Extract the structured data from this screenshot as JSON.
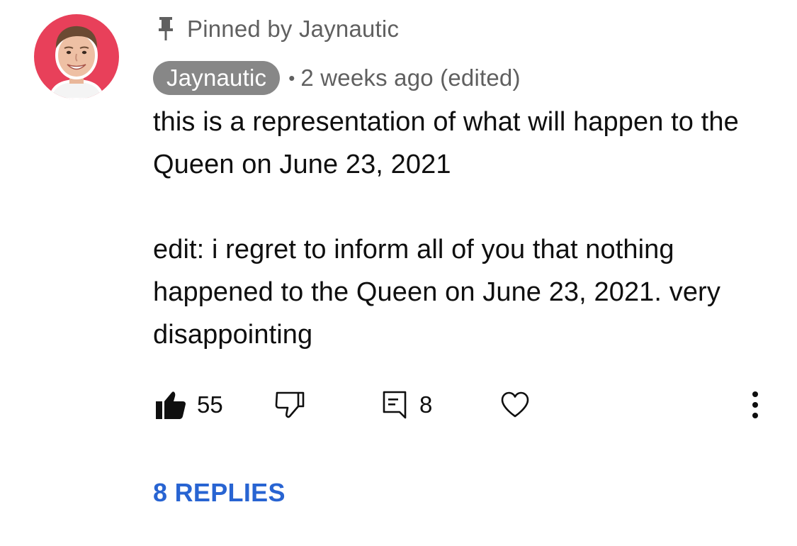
{
  "comment": {
    "pinned_text": "Pinned by Jaynautic",
    "author": "Jaynautic",
    "separator": "•",
    "timestamp": "2 weeks ago (edited)",
    "paragraphs": [
      "this is a representation of what will happen to the Queen on June 23, 2021",
      "edit: i regret to inform all of you that nothing happened to the Queen on June 23, 2021. very disappointing"
    ],
    "like_count": "55",
    "reply_count": "8",
    "replies_link": "8 REPLIES"
  },
  "icons": {
    "avatar": "avatar-photo",
    "pin": "pin-icon",
    "like": "thumbs-up-filled-icon",
    "dislike": "thumbs-down-outline-icon",
    "reply": "comment-icon",
    "heart": "heart-outline-icon",
    "more": "more-vertical-icon"
  },
  "colors": {
    "author_chip_bg": "#878787",
    "avatar_ring": "#e8405a",
    "secondary_text": "#606060",
    "link_blue": "#2864d2"
  }
}
